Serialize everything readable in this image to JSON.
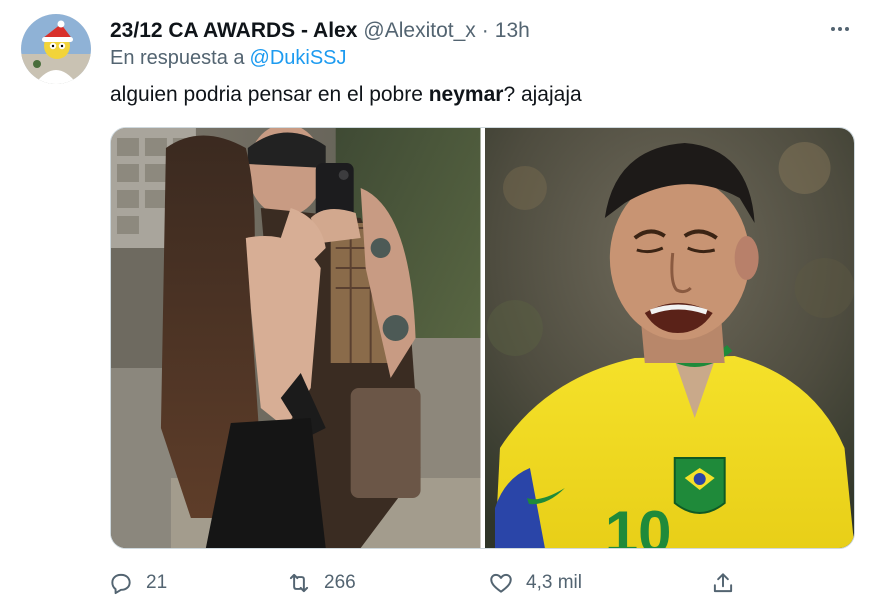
{
  "tweet": {
    "display_name": "23/12 CA AWARDS - Alex",
    "handle": "@Alexitot_x",
    "separator": "·",
    "time": "13h",
    "reply_prefix": "En respuesta a",
    "reply_mention": "@DukiSSJ",
    "text_before": "alguien podria pensar en el pobre ",
    "text_bold": "neymar",
    "text_after": "? ajajaja"
  },
  "media": {
    "jersey_number": "10"
  },
  "actions": {
    "reply_count": "21",
    "retweet_count": "266",
    "like_count": "4,3 mil"
  },
  "icons": {
    "more": "more-options-icon",
    "reply": "reply-icon",
    "retweet": "retweet-icon",
    "like": "like-icon",
    "share": "share-icon"
  },
  "colors": {
    "text": "#0f1419",
    "secondary": "#536471",
    "link": "#1d9bf0",
    "jersey_yellow": "#f5e12a",
    "jersey_green": "#1f8a3a"
  }
}
